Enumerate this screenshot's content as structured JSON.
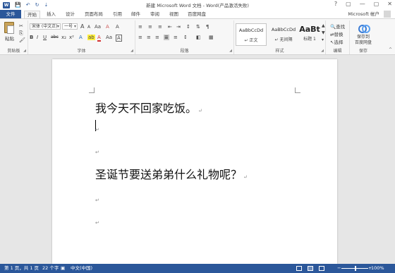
{
  "window": {
    "title": "新建 Microsoft Word 文档 - Word(产品激活失败)",
    "app_icon": "W",
    "help": "?",
    "controls": [
      "▢",
      "—",
      "▢",
      "✕"
    ]
  },
  "qat": {
    "save": "💾",
    "undo": "↶",
    "redo": "↻",
    "more": "⇣"
  },
  "tabs": {
    "file": "文件",
    "items": [
      "开始",
      "插入",
      "设计",
      "页面布局",
      "引用",
      "邮件",
      "审阅",
      "视图",
      "百度网盘"
    ],
    "active": "开始",
    "account": "Microsoft 帐户"
  },
  "ribbon": {
    "clipboard": {
      "paste": "粘贴",
      "label": "剪贴板",
      "cut": "✂",
      "copy": "⎘",
      "format_painter": "🖌"
    },
    "font": {
      "label": "字体",
      "font_name": "宋体 (中文正)",
      "font_size": "一号",
      "row1": [
        "A",
        "A",
        "Aa",
        "A",
        "A"
      ],
      "row2": [
        "B",
        "I",
        "U",
        "abc",
        "x₂",
        "x²",
        "A",
        "ab",
        "A",
        "Aa",
        "A"
      ]
    },
    "paragraph": {
      "label": "段落",
      "row1": [
        "≡",
        "≡",
        "≡",
        "⇤",
        "⇥",
        "↕",
        "⇅",
        "¶"
      ],
      "row2": [
        "≡",
        "≡",
        "≡",
        "≣",
        "≡",
        "↕",
        "◧",
        "▦"
      ]
    },
    "styles": {
      "label": "样式",
      "items": [
        {
          "sample": "AaBbCcDd",
          "name": "↵ 正文"
        },
        {
          "sample": "AaBbCcDd",
          "name": "↵ 无间隔"
        },
        {
          "sample": "AaBt",
          "name": "标题 1"
        }
      ]
    },
    "editing": {
      "label": "编辑",
      "find": "查找",
      "replace": "替换",
      "select": "选择"
    },
    "save": {
      "label": "保存",
      "button": "保存到",
      "button2": "百度网盘"
    },
    "collapse": "^"
  },
  "document": {
    "paragraphs": [
      {
        "text": "我今天不回家吃饭。",
        "mark": "↵"
      },
      {
        "text": "圣诞节要送弟弟什么礼物呢？",
        "mark": "↵"
      }
    ],
    "empty_marks": [
      "↵",
      "↵",
      "↵",
      "↵"
    ]
  },
  "status": {
    "page": "第 1 页，共 1 页",
    "words": "22 个字",
    "language": "中文(中国)",
    "zoom": "100%",
    "zoom_level": 0.5
  }
}
